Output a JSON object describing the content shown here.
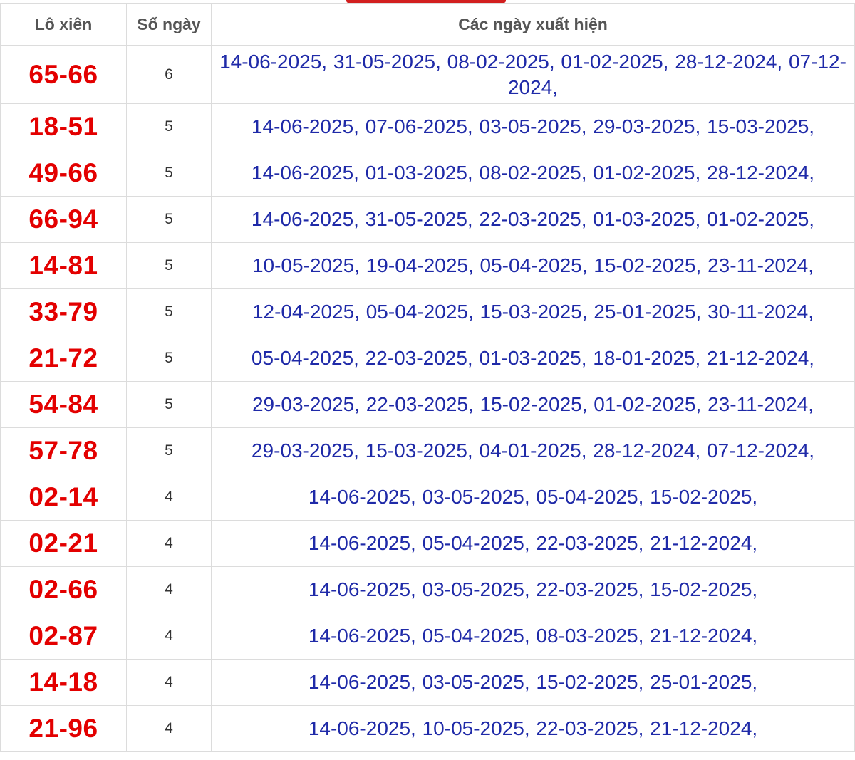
{
  "header": {
    "col_pair": "Lô xiên",
    "col_count": "Số ngày",
    "col_dates": "Các ngày xuất hiện"
  },
  "accent_color": "#e30000",
  "date_color": "#1f2aa8",
  "rows": [
    {
      "pair": "65-66",
      "count": "6",
      "dates": "14-06-2025, 31-05-2025, 08-02-2025, 01-02-2025, 28-12-2024, 07-12-2024,"
    },
    {
      "pair": "18-51",
      "count": "5",
      "dates": "14-06-2025, 07-06-2025, 03-05-2025, 29-03-2025, 15-03-2025,"
    },
    {
      "pair": "49-66",
      "count": "5",
      "dates": "14-06-2025, 01-03-2025, 08-02-2025, 01-02-2025, 28-12-2024,"
    },
    {
      "pair": "66-94",
      "count": "5",
      "dates": "14-06-2025, 31-05-2025, 22-03-2025, 01-03-2025, 01-02-2025,"
    },
    {
      "pair": "14-81",
      "count": "5",
      "dates": "10-05-2025, 19-04-2025, 05-04-2025, 15-02-2025, 23-11-2024,"
    },
    {
      "pair": "33-79",
      "count": "5",
      "dates": "12-04-2025, 05-04-2025, 15-03-2025, 25-01-2025, 30-11-2024,"
    },
    {
      "pair": "21-72",
      "count": "5",
      "dates": "05-04-2025, 22-03-2025, 01-03-2025, 18-01-2025, 21-12-2024,"
    },
    {
      "pair": "54-84",
      "count": "5",
      "dates": "29-03-2025, 22-03-2025, 15-02-2025, 01-02-2025, 23-11-2024,"
    },
    {
      "pair": "57-78",
      "count": "5",
      "dates": "29-03-2025, 15-03-2025, 04-01-2025, 28-12-2024, 07-12-2024,"
    },
    {
      "pair": "02-14",
      "count": "4",
      "dates": "14-06-2025, 03-05-2025, 05-04-2025, 15-02-2025,"
    },
    {
      "pair": "02-21",
      "count": "4",
      "dates": "14-06-2025, 05-04-2025, 22-03-2025, 21-12-2024,"
    },
    {
      "pair": "02-66",
      "count": "4",
      "dates": "14-06-2025, 03-05-2025, 22-03-2025, 15-02-2025,"
    },
    {
      "pair": "02-87",
      "count": "4",
      "dates": "14-06-2025, 05-04-2025, 08-03-2025, 21-12-2024,"
    },
    {
      "pair": "14-18",
      "count": "4",
      "dates": "14-06-2025, 03-05-2025, 15-02-2025, 25-01-2025,"
    },
    {
      "pair": "21-96",
      "count": "4",
      "dates": "14-06-2025, 10-05-2025, 22-03-2025, 21-12-2024,"
    }
  ]
}
